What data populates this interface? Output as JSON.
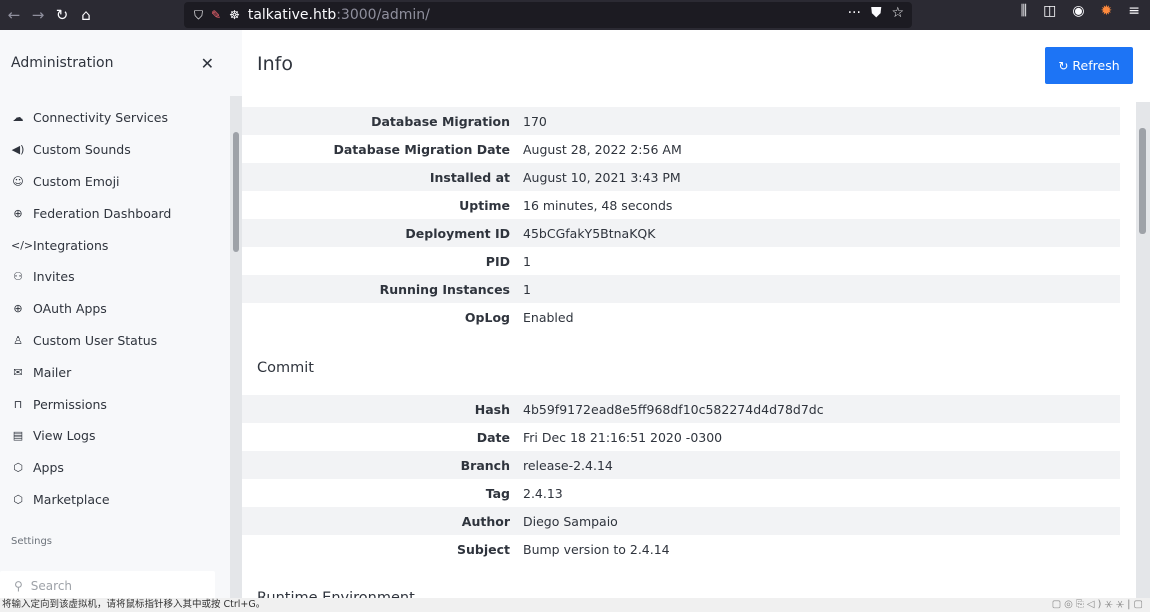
{
  "browser": {
    "url_host": "talkative.htb",
    "url_path": ":3000/admin/"
  },
  "sidebar": {
    "title": "Administration",
    "items": [
      {
        "label": "Connectivity Services",
        "icon": "cloud-icon",
        "glyph": "☁"
      },
      {
        "label": "Custom Sounds",
        "icon": "volume-icon",
        "glyph": "◀)"
      },
      {
        "label": "Custom Emoji",
        "icon": "emoji-icon",
        "glyph": "☺"
      },
      {
        "label": "Federation Dashboard",
        "icon": "globe-icon",
        "glyph": "⊕"
      },
      {
        "label": "Integrations",
        "icon": "code-icon",
        "glyph": "</>"
      },
      {
        "label": "Invites",
        "icon": "invite-icon",
        "glyph": "⚇"
      },
      {
        "label": "OAuth Apps",
        "icon": "globe-icon",
        "glyph": "⊕"
      },
      {
        "label": "Custom User Status",
        "icon": "user-icon",
        "glyph": "♙"
      },
      {
        "label": "Mailer",
        "icon": "mail-icon",
        "glyph": "✉"
      },
      {
        "label": "Permissions",
        "icon": "lock-icon",
        "glyph": "⊓"
      },
      {
        "label": "View Logs",
        "icon": "file-icon",
        "glyph": "▤"
      },
      {
        "label": "Apps",
        "icon": "cube-icon",
        "glyph": "⬡"
      },
      {
        "label": "Marketplace",
        "icon": "cube-icon",
        "glyph": "⬡"
      }
    ],
    "settings_label": "Settings",
    "search_placeholder": "Search"
  },
  "main": {
    "title": "Info",
    "refresh_label": "Refresh",
    "info_rows": [
      {
        "key": "Database Migration",
        "value": "170"
      },
      {
        "key": "Database Migration Date",
        "value": "August 28, 2022 2:56 AM"
      },
      {
        "key": "Installed at",
        "value": "August 10, 2021 3:43 PM"
      },
      {
        "key": "Uptime",
        "value": "16 minutes, 48 seconds"
      },
      {
        "key": "Deployment ID",
        "value": "45bCGfakY5BtnaKQK"
      },
      {
        "key": "PID",
        "value": "1"
      },
      {
        "key": "Running Instances",
        "value": "1"
      },
      {
        "key": "OpLog",
        "value": "Enabled"
      }
    ],
    "commit_title": "Commit",
    "commit_rows": [
      {
        "key": "Hash",
        "value": "4b59f9172ead8e5ff968df10c582274d4d78d7dc"
      },
      {
        "key": "Date",
        "value": "Fri Dec 18 21:16:51 2020 -0300"
      },
      {
        "key": "Branch",
        "value": "release-2.4.14"
      },
      {
        "key": "Tag",
        "value": "2.4.13"
      },
      {
        "key": "Author",
        "value": "Diego Sampaio"
      },
      {
        "key": "Subject",
        "value": "Bump version to 2.4.14"
      }
    ],
    "runtime_title": "Runtime Environment"
  },
  "statusbar": {
    "text": "将输入定向到该虚拟机，请将鼠标指针移入其中或按 Ctrl+G。"
  }
}
